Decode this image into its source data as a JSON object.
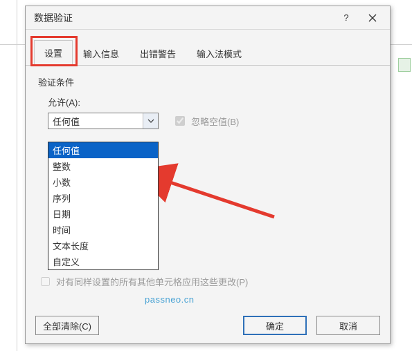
{
  "dialog": {
    "title": "数据验证",
    "help_label": "?",
    "close_label": "×"
  },
  "tabs": {
    "settings": "设置",
    "input_msg": "输入信息",
    "error_alert": "出错警告",
    "ime_mode": "输入法模式"
  },
  "panel": {
    "criteria_label": "验证条件",
    "allow_label": "允许(A):",
    "allow_value": "任何值",
    "ignore_blank_label": "忽略空值(B)",
    "ignore_blank_checked": true,
    "apply_all_label": "对有同样设置的所有其他单元格应用这些更改(P)",
    "apply_all_checked": false
  },
  "dropdown_items": [
    "任何值",
    "整数",
    "小数",
    "序列",
    "日期",
    "时间",
    "文本长度",
    "自定义"
  ],
  "buttons": {
    "clear_all": "全部清除(C)",
    "ok": "确定",
    "cancel": "取消"
  },
  "watermark": "passneo.cn"
}
